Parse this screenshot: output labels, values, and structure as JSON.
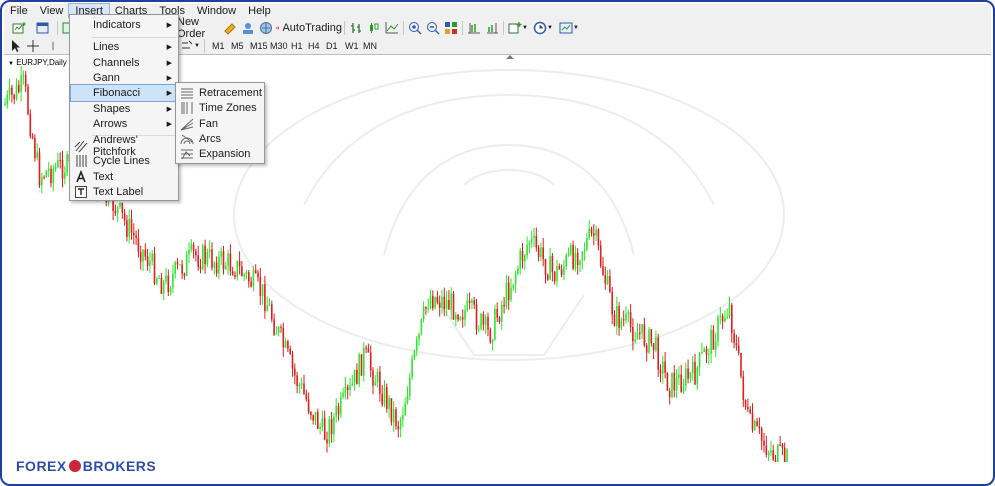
{
  "menubar": [
    "File",
    "View",
    "Insert",
    "Charts",
    "Tools",
    "Window",
    "Help"
  ],
  "toolbar": {
    "new_order": "New Order",
    "autotrading": "AutoTrading"
  },
  "timeframes": [
    "M1",
    "M5",
    "M15",
    "M30",
    "H1",
    "H4",
    "D1",
    "W1",
    "MN"
  ],
  "chart": {
    "label": "EURJPY,Daily"
  },
  "insert_menu": {
    "items": [
      {
        "label": "Indicators",
        "arrow": true
      },
      {
        "label": "Lines",
        "arrow": true
      },
      {
        "label": "Channels",
        "arrow": true
      },
      {
        "label": "Gann",
        "arrow": true
      },
      {
        "label": "Fibonacci",
        "arrow": true,
        "highlighted": true
      },
      {
        "label": "Shapes",
        "arrow": true
      },
      {
        "label": "Arrows",
        "arrow": true
      },
      {
        "label": "Andrews' Pitchfork",
        "arrow": false
      },
      {
        "label": "Cycle Lines",
        "arrow": false
      },
      {
        "label": "Text",
        "arrow": false
      },
      {
        "label": "Text Label",
        "arrow": false
      }
    ]
  },
  "fibonacci_submenu": {
    "items": [
      {
        "label": "Retracement"
      },
      {
        "label": "Time Zones"
      },
      {
        "label": "Fan"
      },
      {
        "label": "Arcs"
      },
      {
        "label": "Expansion"
      }
    ]
  },
  "brand": {
    "left": "FOREX",
    "right": "BROKERS"
  },
  "colors": {
    "bull": "#2ee62e",
    "bear": "#e01d1d",
    "accent": "#1f3f9f",
    "brand": "#2b4fa6"
  }
}
